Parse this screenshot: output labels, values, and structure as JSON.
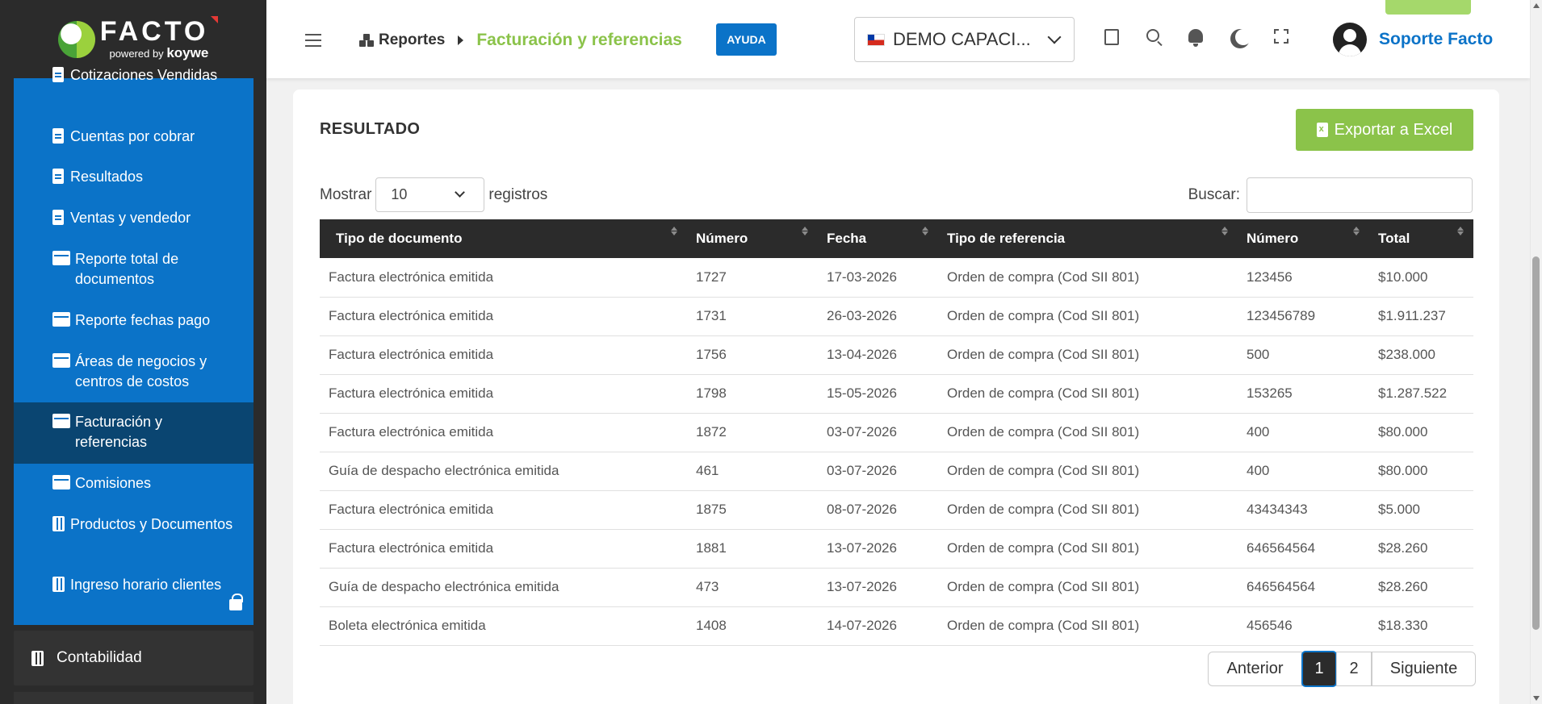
{
  "logo": {
    "word": "FACTO",
    "powered": "powered by",
    "brand": "koywe"
  },
  "sidebar": {
    "items": [
      {
        "label": "Cotizaciones Vendidas",
        "icon": "document-icon"
      },
      {
        "label": "Cuentas por cobrar",
        "icon": "document-icon"
      },
      {
        "label": "Resultados",
        "icon": "document-icon"
      },
      {
        "label": "Ventas y vendedor",
        "icon": "document-icon"
      },
      {
        "label": "Reporte total de documentos",
        "icon": "archive-icon"
      },
      {
        "label": "Reporte fechas pago",
        "icon": "archive-icon"
      },
      {
        "label": "Áreas de negocios y centros de costos",
        "icon": "archive-icon"
      },
      {
        "label": "Facturación y referencias",
        "icon": "archive-icon",
        "active": true
      },
      {
        "label": "Comisiones",
        "icon": "archive-icon"
      },
      {
        "label": "Productos y Documentos",
        "icon": "calculator-icon"
      },
      {
        "label": "Ingreso horario clientes",
        "icon": "calculator-icon",
        "locked": true
      }
    ],
    "section_contabilidad": "Contabilidad"
  },
  "header": {
    "breadcrumb_root": "Reportes",
    "breadcrumb_current": "Facturación y referencias",
    "help_label": "AYUDA",
    "company": "DEMO CAPACI...",
    "user_name": "Soporte Facto"
  },
  "content": {
    "title": "RESULTADO",
    "export_label": "Exportar a Excel",
    "show_label": "Mostrar",
    "length_value": "10",
    "records_label": "registros",
    "search_label": "Buscar:",
    "search_value": ""
  },
  "table": {
    "headers": [
      "Tipo de documento",
      "Número",
      "Fecha",
      "Tipo de referencia",
      "Número",
      "Total"
    ],
    "rows": [
      [
        "Factura electrónica emitida",
        "1727",
        "17-03-2026",
        "Orden de compra (Cod SII 801)",
        "123456",
        "$10.000"
      ],
      [
        "Factura electrónica emitida",
        "1731",
        "26-03-2026",
        "Orden de compra (Cod SII 801)",
        "123456789",
        "$1.911.237"
      ],
      [
        "Factura electrónica emitida",
        "1756",
        "13-04-2026",
        "Orden de compra (Cod SII 801)",
        "500",
        "$238.000"
      ],
      [
        "Factura electrónica emitida",
        "1798",
        "15-05-2026",
        "Orden de compra (Cod SII 801)",
        "153265",
        "$1.287.522"
      ],
      [
        "Factura electrónica emitida",
        "1872",
        "03-07-2026",
        "Orden de compra (Cod SII 801)",
        "400",
        "$80.000"
      ],
      [
        "Guía de despacho electrónica emitida",
        "461",
        "03-07-2026",
        "Orden de compra (Cod SII 801)",
        "400",
        "$80.000"
      ],
      [
        "Factura electrónica emitida",
        "1875",
        "08-07-2026",
        "Orden de compra (Cod SII 801)",
        "43434343",
        "$5.000"
      ],
      [
        "Factura electrónica emitida",
        "1881",
        "13-07-2026",
        "Orden de compra (Cod SII 801)",
        "646564564",
        "$28.260"
      ],
      [
        "Guía de despacho electrónica emitida",
        "473",
        "13-07-2026",
        "Orden de compra (Cod SII 801)",
        "646564564",
        "$28.260"
      ],
      [
        "Boleta electrónica emitida",
        "1408",
        "14-07-2026",
        "Orden de compra (Cod SII 801)",
        "456546",
        "$18.330"
      ]
    ]
  },
  "pagination": {
    "prev": "Anterior",
    "pages": [
      "1",
      "2"
    ],
    "current": "1",
    "next": "Siguiente"
  },
  "colors": {
    "sidebar_blue": "#0b73c8",
    "sidebar_active": "#0a4571",
    "accent_green": "#8bc34a",
    "dark": "#2b2b2b"
  }
}
